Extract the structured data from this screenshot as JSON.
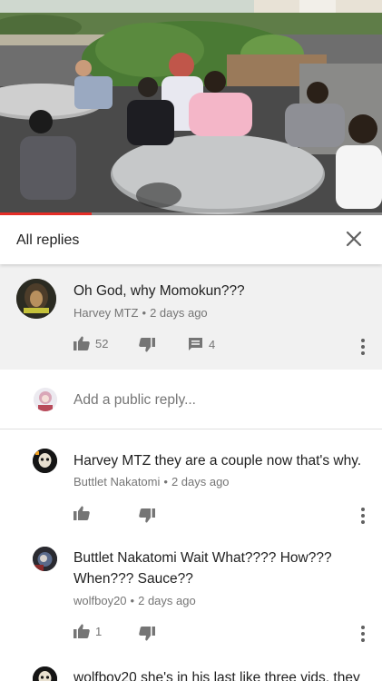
{
  "video": {
    "progress_percent": 24
  },
  "replies_panel": {
    "title": "All replies"
  },
  "parent_comment": {
    "text": "Oh God, why Momokun???",
    "author": "Harvey MTZ",
    "time": "2 days ago",
    "like_count": "52",
    "reply_count": "4"
  },
  "add_reply": {
    "placeholder": "Add a public reply..."
  },
  "replies": [
    {
      "text": "Harvey MTZ they are a couple now that's why.",
      "author": "Buttlet Nakatomi",
      "time": "2 days ago",
      "like_count": ""
    },
    {
      "text_line1": "Buttlet Nakatomi Wait What???? How???",
      "text_line2": "When??? Sauce??",
      "author": "wolfboy20",
      "time": "2 days ago",
      "like_count": "1"
    },
    {
      "text": "wolfboy20 she's in his last like three vids, they"
    }
  ],
  "separator": "•",
  "colors": {
    "progress": "#e52d27",
    "icon_gray": "#757575",
    "parent_bg": "#f1f1f1"
  }
}
